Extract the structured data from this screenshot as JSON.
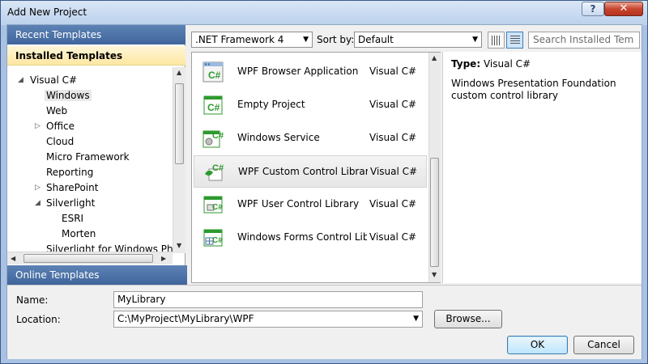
{
  "window": {
    "title": "Add New Project",
    "help_label": "?",
    "close_label": "✕"
  },
  "left": {
    "recent_templates": "Recent Templates",
    "installed_templates": "Installed Templates",
    "online_templates": "Online Templates",
    "tree": [
      {
        "label": "Visual C#",
        "arrow": "◢"
      },
      {
        "label": "Windows",
        "arrow": ""
      },
      {
        "label": "Web",
        "arrow": ""
      },
      {
        "label": "Office",
        "arrow": "▷"
      },
      {
        "label": "Cloud",
        "arrow": ""
      },
      {
        "label": "Micro Framework",
        "arrow": ""
      },
      {
        "label": "Reporting",
        "arrow": ""
      },
      {
        "label": "SharePoint",
        "arrow": "▷"
      },
      {
        "label": "Silverlight",
        "arrow": "◢"
      },
      {
        "label": "ESRI",
        "arrow": ""
      },
      {
        "label": "Morten",
        "arrow": ""
      },
      {
        "label": "Silverlight for Windows Phone",
        "arrow": ""
      }
    ]
  },
  "toolbar": {
    "framework": ".NET Framework 4",
    "sort_by_label": "Sort by:",
    "sort_value": "Default",
    "search_placeholder": "Search Installed Tem"
  },
  "templates": [
    {
      "name": "WPF Browser Application",
      "lang": "Visual C#",
      "icon": "wpf-browser-app-icon"
    },
    {
      "name": "Empty Project",
      "lang": "Visual C#",
      "icon": "empty-project-icon"
    },
    {
      "name": "Windows Service",
      "lang": "Visual C#",
      "icon": "windows-service-icon"
    },
    {
      "name": "WPF Custom Control Library",
      "lang": "Visual C#",
      "icon": "wpf-custom-control-icon"
    },
    {
      "name": "WPF User Control Library",
      "lang": "Visual C#",
      "icon": "wpf-user-control-icon"
    },
    {
      "name": "Windows Forms Control Library",
      "lang": "Visual C#",
      "icon": "winforms-control-icon"
    }
  ],
  "detail": {
    "type_label": "Type:",
    "type_value": "Visual C#",
    "description": "Windows Presentation Foundation custom control library"
  },
  "form": {
    "name_label": "Name:",
    "name_value": "MyLibrary",
    "location_label": "Location:",
    "location_value": "C:\\MyProject\\MyLibrary\\WPF",
    "browse_label": "Browse...",
    "ok_label": "OK",
    "cancel_label": "Cancel"
  },
  "colors": {
    "header_blue": "#4a6fa5",
    "installed_highlight": "#fde7a2",
    "csharp_green": "#2e9a2e"
  }
}
